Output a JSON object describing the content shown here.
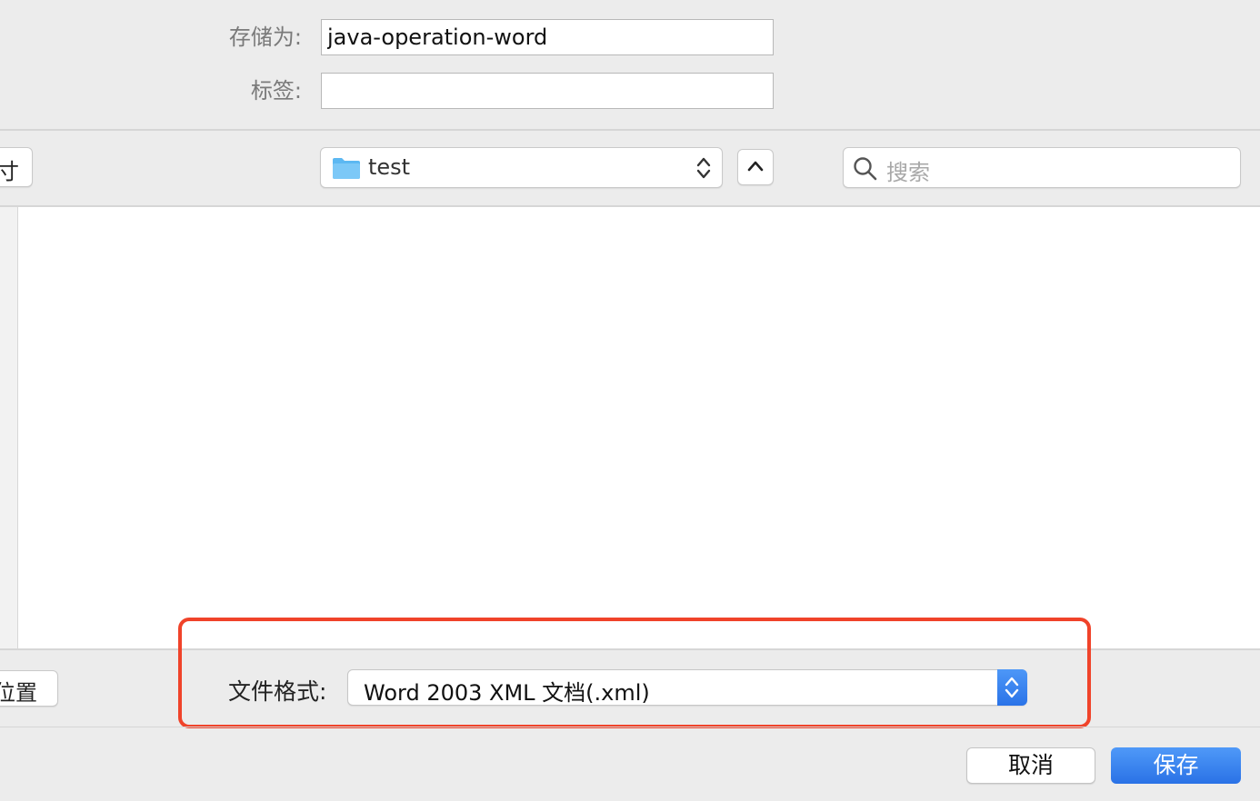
{
  "form": {
    "save_as_label": "存储为:",
    "save_as_value": "java-operation-word",
    "tags_label": "标签:",
    "tags_value": ""
  },
  "toolbar": {
    "left_button_label": "寸",
    "location": "test",
    "search_placeholder": "搜索"
  },
  "bottom": {
    "left_button_label": "位置",
    "file_format_label": "文件格式:",
    "file_format_value": "Word 2003 XML 文档(.xml)"
  },
  "actions": {
    "cancel_label": "取消",
    "save_label": "保存"
  },
  "colors": {
    "accent": "#2a73e8",
    "highlight": "#f0432a",
    "folder": "#5cb8f2"
  }
}
